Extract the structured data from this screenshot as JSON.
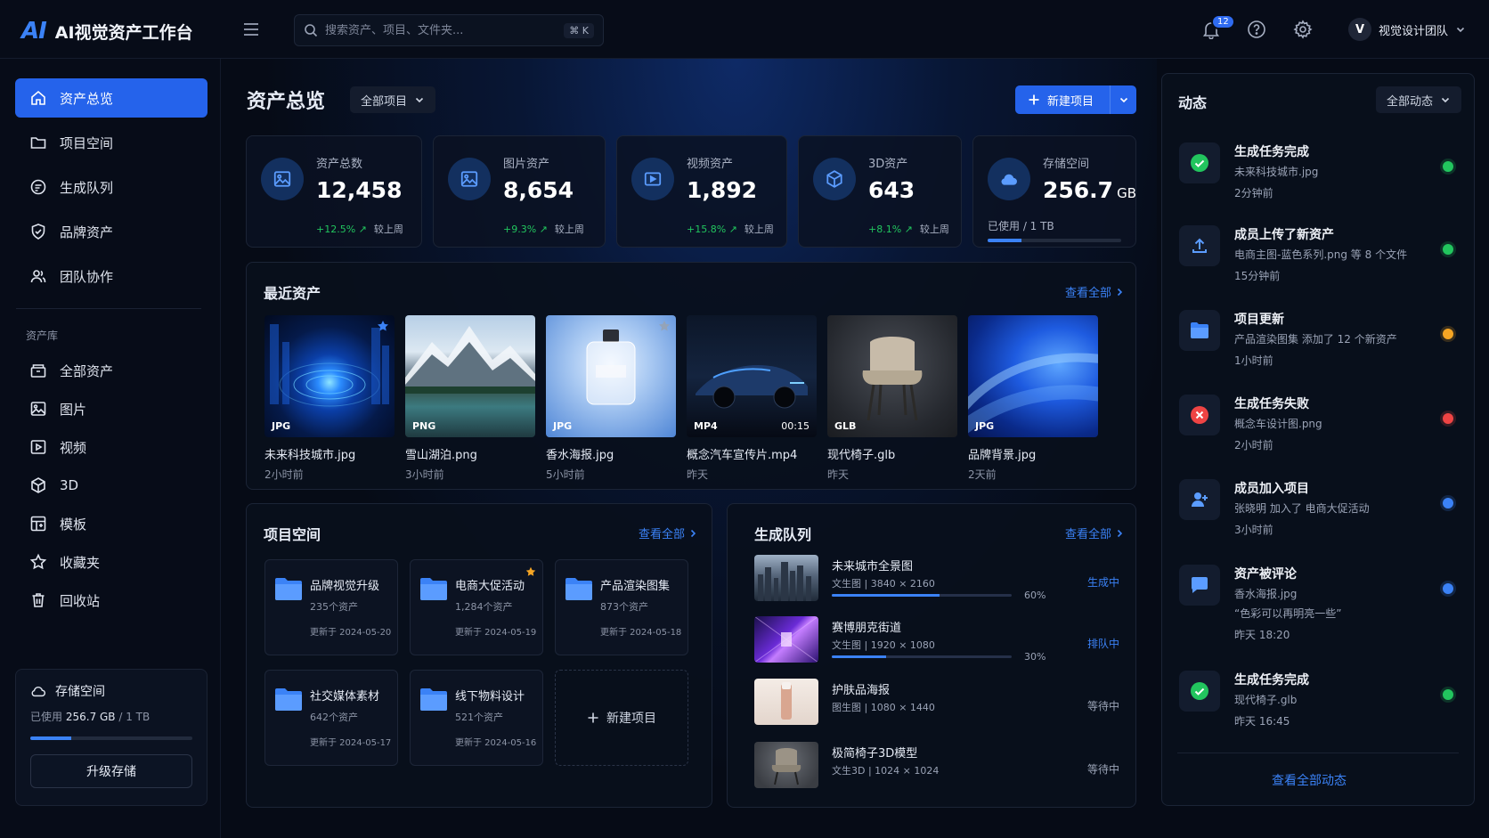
{
  "app": {
    "logo_mark": "AI",
    "title": "AI视觉资产工作台"
  },
  "search": {
    "placeholder": "搜索资产、项目、文件夹...",
    "shortcut": "⌘ K"
  },
  "topbar": {
    "notification_count": "12",
    "user_initial": "V",
    "user_name": "视觉设计团队"
  },
  "sidebar": {
    "nav": [
      {
        "label": "资产总览",
        "icon": "home-icon",
        "active": true
      },
      {
        "label": "项目空间",
        "icon": "folder-icon"
      },
      {
        "label": "生成队列",
        "icon": "queue-icon"
      },
      {
        "label": "品牌资产",
        "icon": "shield-icon"
      },
      {
        "label": "团队协作",
        "icon": "team-icon"
      }
    ],
    "library_label": "资产库",
    "library": [
      {
        "label": "全部资产",
        "icon": "archive-icon"
      },
      {
        "label": "图片",
        "icon": "image-icon"
      },
      {
        "label": "视频",
        "icon": "video-icon"
      },
      {
        "label": "3D",
        "icon": "cube-icon"
      },
      {
        "label": "模板",
        "icon": "template-icon"
      },
      {
        "label": "收藏夹",
        "icon": "star-icon"
      },
      {
        "label": "回收站",
        "icon": "trash-icon"
      }
    ],
    "storage": {
      "title": "存储空间",
      "used_prefix": "已使用",
      "used": "256.7 GB",
      "total": "/ 1 TB",
      "fraction": 0.2507,
      "upgrade_label": "升级存储"
    }
  },
  "main": {
    "title": "资产总览",
    "project_filter": "全部项目",
    "new_project_label": "新建项目",
    "stats": [
      {
        "label": "资产总数",
        "value": "12,458",
        "change": "+12.5% ↗",
        "compare": "较上周",
        "icon": "image-icon"
      },
      {
        "label": "图片资产",
        "value": "8,654",
        "change": "+9.3% ↗",
        "compare": "较上周",
        "icon": "image-icon"
      },
      {
        "label": "视频资产",
        "value": "1,892",
        "change": "+15.8% ↗",
        "compare": "较上周",
        "icon": "video-icon"
      },
      {
        "label": "3D资产",
        "value": "643",
        "change": "+8.1% ↗",
        "compare": "较上周",
        "icon": "cube-icon"
      },
      {
        "label": "存储空间",
        "value": "256.7",
        "unit": "GB",
        "usage": "已使用 / 1 TB",
        "fraction": 0.2507,
        "icon": "cloud-icon"
      }
    ],
    "recent": {
      "title": "最近资产",
      "view_all": "查看全部",
      "items": [
        {
          "name": "未来科技城市.jpg",
          "time": "2小时前",
          "format": "JPG",
          "starred": true
        },
        {
          "name": "雪山湖泊.png",
          "time": "3小时前",
          "format": "PNG"
        },
        {
          "name": "香水海报.jpg",
          "time": "5小时前",
          "format": "JPG",
          "starred": true
        },
        {
          "name": "概念汽车宣传片.mp4",
          "time": "昨天",
          "format": "MP4",
          "duration": "00:15"
        },
        {
          "name": "现代椅子.glb",
          "time": "昨天",
          "format": "GLB"
        },
        {
          "name": "品牌背景.jpg",
          "time": "2天前",
          "format": "JPG"
        }
      ]
    },
    "projects": {
      "title": "项目空间",
      "view_all": "查看全部",
      "items": [
        {
          "name": "品牌视觉升级",
          "count": "235个资产",
          "updated": "更新于 2024-05-20"
        },
        {
          "name": "电商大促活动",
          "count": "1,284个资产",
          "updated": "更新于 2024-05-19",
          "starred": true
        },
        {
          "name": "产品渲染图集",
          "count": "873个资产",
          "updated": "更新于 2024-05-18"
        },
        {
          "name": "社交媒体素材",
          "count": "642个资产",
          "updated": "更新于 2024-05-17"
        },
        {
          "name": "线下物料设计",
          "count": "521个资产",
          "updated": "更新于 2024-05-16"
        }
      ],
      "new_label": "新建项目"
    },
    "queue": {
      "title": "生成队列",
      "view_all": "查看全部",
      "items": [
        {
          "name": "未来城市全景图",
          "info": "文生图 | 3840 × 2160",
          "progress": 60,
          "progress_label": "60%",
          "status": "生成中"
        },
        {
          "name": "赛博朋克街道",
          "info": "文生图 | 1920 × 1080",
          "progress": 30,
          "progress_label": "30%",
          "status": "排队中"
        },
        {
          "name": "护肤品海报",
          "info": "图生图 | 1080 × 1440",
          "status": "等待中"
        },
        {
          "name": "极简椅子3D模型",
          "info": "文生3D | 1024 × 1024",
          "status": "等待中"
        }
      ]
    }
  },
  "activity": {
    "title": "动态",
    "filter": "全部动态",
    "items": [
      {
        "title": "生成任务完成",
        "desc": "未来科技城市.jpg",
        "time": "2分钟前",
        "icon": "check-circle-icon",
        "color": "#22c55e"
      },
      {
        "title": "成员上传了新资产",
        "desc": "电商主图-蓝色系列.png 等 8 个文件",
        "time": "15分钟前",
        "icon": "upload-icon",
        "color": "#22c55e"
      },
      {
        "title": "项目更新",
        "desc": "产品渲染图集 添加了 12 个新资产",
        "time": "1小时前",
        "icon": "folder-icon",
        "color": "#f5a524"
      },
      {
        "title": "生成任务失败",
        "desc": "概念车设计图.png",
        "time": "2小时前",
        "icon": "error-icon",
        "color": "#ef4444"
      },
      {
        "title": "成员加入项目",
        "desc": "张晓明 加入了 电商大促活动",
        "time": "3小时前",
        "icon": "user-add-icon",
        "color": "#3b82f6"
      },
      {
        "title": "资产被评论",
        "desc": "香水海报.jpg",
        "quote": "“色彩可以再明亮一些”",
        "time": "昨天 18:20",
        "icon": "comment-icon",
        "color": "#3b82f6"
      },
      {
        "title": "生成任务完成",
        "desc": "现代椅子.glb",
        "time": "昨天 16:45",
        "icon": "check-circle-icon",
        "color": "#22c55e"
      }
    ],
    "view_all": "查看全部动态"
  }
}
